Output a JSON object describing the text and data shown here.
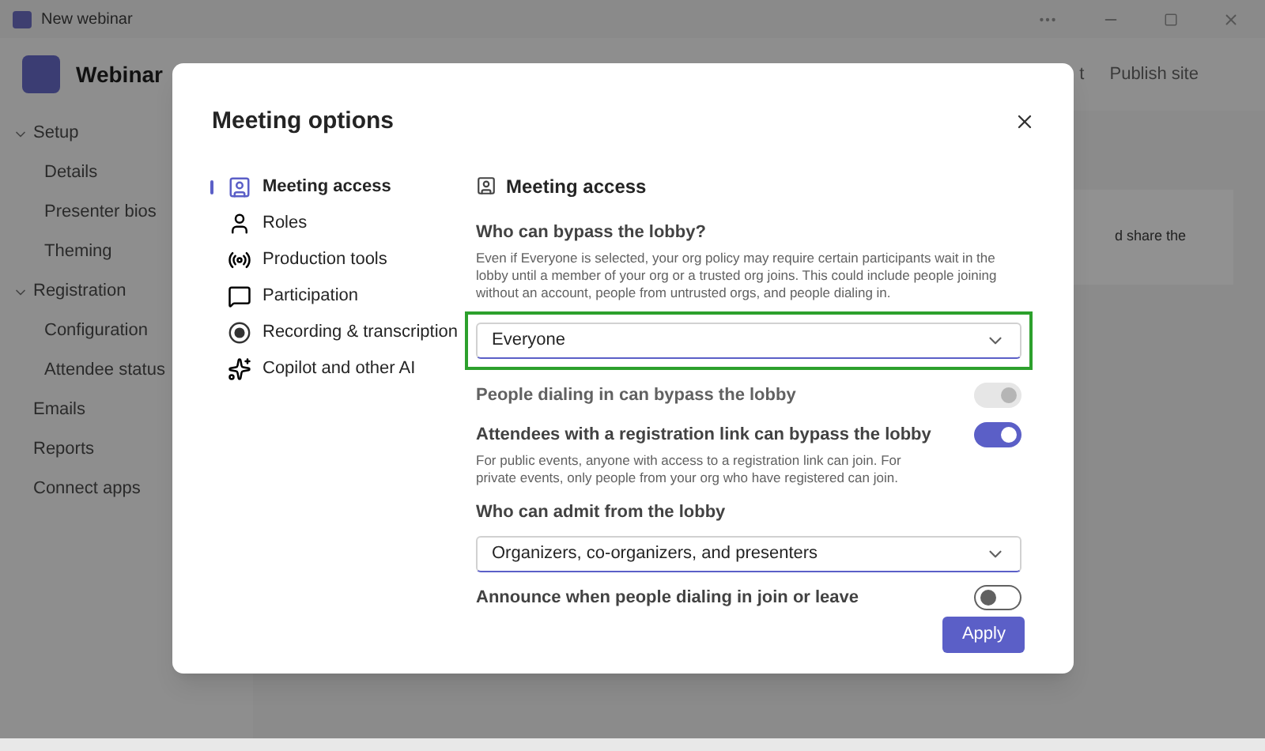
{
  "window": {
    "title": "New webinar"
  },
  "header": {
    "title": "Webinar",
    "actions": [
      "t",
      "Publish site"
    ]
  },
  "sidebar": [
    {
      "label": "Setup",
      "expanded": true,
      "children": [
        {
          "label": "Details"
        },
        {
          "label": "Presenter bios"
        },
        {
          "label": "Theming"
        }
      ]
    },
    {
      "label": "Registration",
      "expanded": true,
      "children": [
        {
          "label": "Configuration"
        },
        {
          "label": "Attendee status"
        }
      ]
    },
    {
      "label": "Emails"
    },
    {
      "label": "Reports"
    },
    {
      "label": "Connect apps"
    }
  ],
  "background_text": "d share the",
  "modal": {
    "title": "Meeting options",
    "nav": [
      {
        "label": "Meeting access",
        "selected": true
      },
      {
        "label": "Roles",
        "selected": false
      },
      {
        "label": "Production tools",
        "selected": false
      },
      {
        "label": "Participation",
        "selected": false
      },
      {
        "label": "Recording & transcription",
        "selected": false
      },
      {
        "label": "Copilot and other AI",
        "selected": false
      }
    ],
    "section_title": "Meeting access",
    "settings": [
      {
        "kind": "dropdown",
        "label": "Who can bypass the lobby?",
        "description": "Even if Everyone is selected, your org policy may require certain participants wait in the lobby until a member of your org or a trusted org joins. This could include people joining without an account, people from untrusted orgs, and people dialing in.",
        "value": "Everyone",
        "highlighted": true
      },
      {
        "kind": "toggle",
        "label": "People dialing in can bypass the lobby",
        "on": true,
        "disabled": true
      },
      {
        "kind": "toggle",
        "label": "Attendees with a registration link can bypass the lobby",
        "description": "For public events, anyone with access to a registration link can join. For private events, only people from your org who have registered can join.",
        "on": true,
        "disabled": false
      },
      {
        "kind": "dropdown",
        "label": "Who can admit from the lobby",
        "value": "Organizers, co-organizers, and presenters",
        "highlighted": false
      },
      {
        "kind": "toggle",
        "label": "Announce when people dialing in join or leave",
        "on": false,
        "disabled": false
      }
    ],
    "apply": "Apply"
  }
}
